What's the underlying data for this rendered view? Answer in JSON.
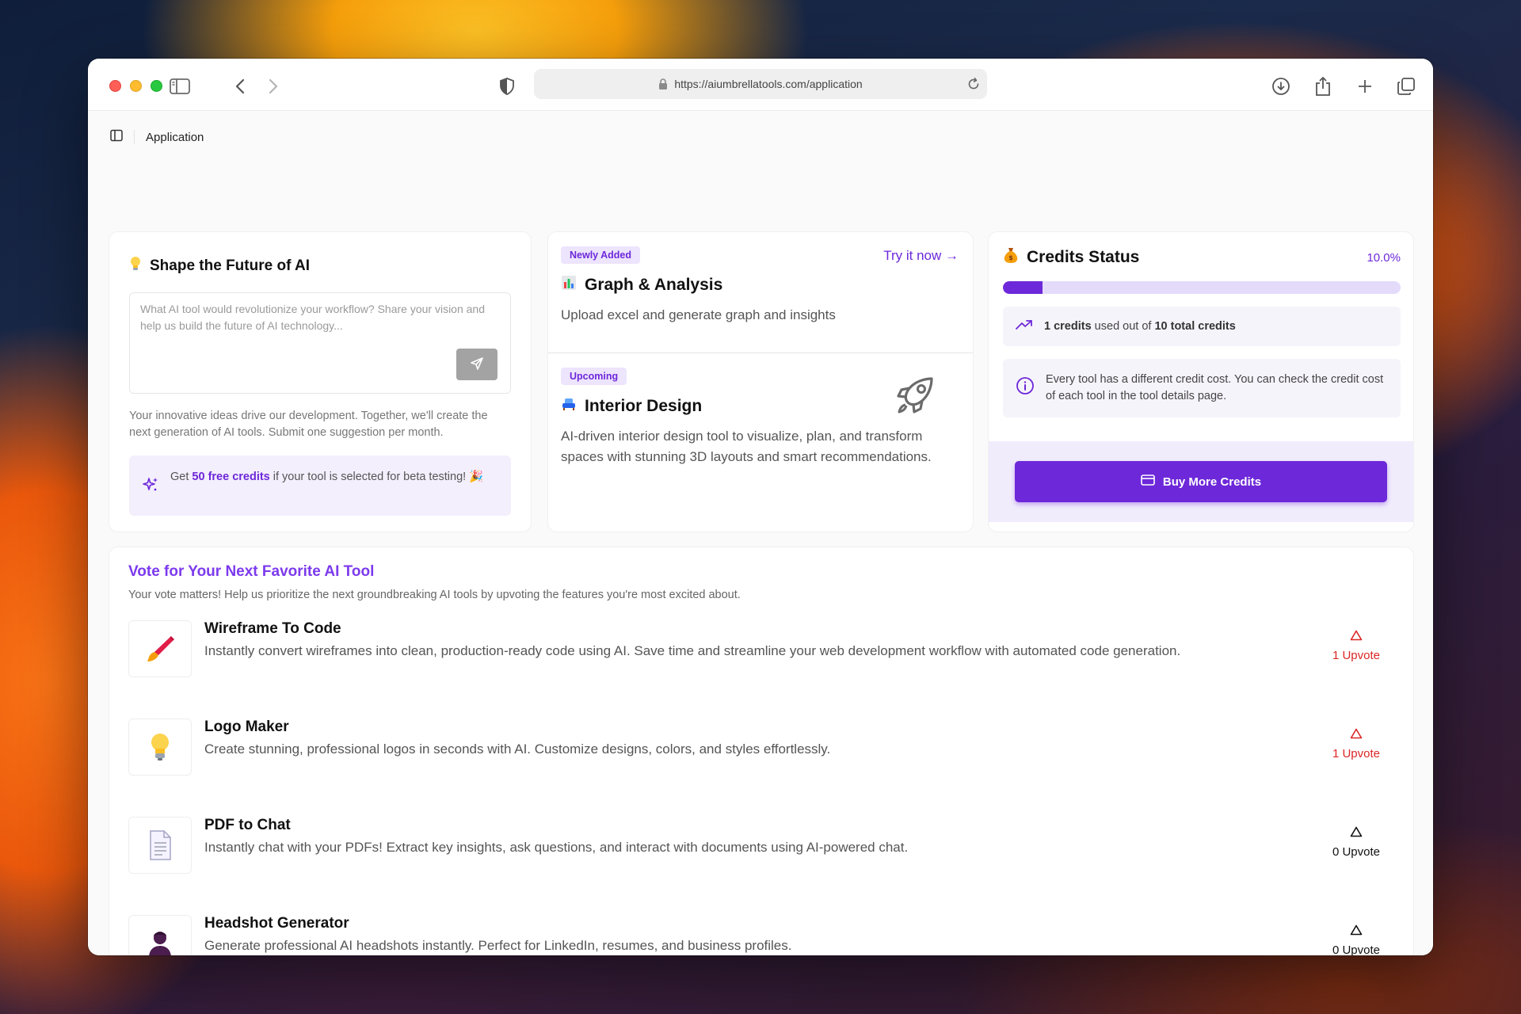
{
  "browser": {
    "url": "https://aiumbrellatools.com/application"
  },
  "breadcrumb": {
    "current": "Application"
  },
  "suggest": {
    "title": "Shape the Future of AI",
    "placeholder": "What AI tool would revolutionize your workflow? Share your vision and help us build the future of AI technology...",
    "description": "Your innovative ideas drive our development. Together, we'll create the next generation of AI tools. Submit one suggestion per month.",
    "promo_prefix": "Get ",
    "promo_highlight": "50 free credits",
    "promo_suffix": " if your tool is selected for beta testing! 🎉"
  },
  "tools": {
    "graph": {
      "badge": "Newly Added",
      "link": "Try it now →",
      "title": "Graph & Analysis",
      "description": "Upload excel and generate graph and insights"
    },
    "interior": {
      "badge": "Upcoming",
      "title": "Interior Design",
      "description": "AI-driven interior design tool to visualize, plan, and transform spaces with stunning 3D layouts and smart recommendations."
    }
  },
  "credits": {
    "title": "Credits Status",
    "percent_label": "10.0%",
    "used_fraction": 0.1,
    "used_bold": "1 credits",
    "used_mid": " used out of ",
    "total_bold": "10 total credits",
    "info": "Every tool has a different credit cost. You can check the credit cost of each tool in the tool details page.",
    "buy_label": "Buy More Credits"
  },
  "vote": {
    "title": "Vote for Your Next Favorite AI Tool",
    "subtitle": "Your vote matters! Help us prioritize the next groundbreaking AI tools by upvoting the features you're most excited about.",
    "items": [
      {
        "name": "Wireframe To Code",
        "description": "Instantly convert wireframes into clean, production-ready code using AI. Save time and streamline your web development workflow with automated code generation.",
        "upvotes": "1 Upvote",
        "icon": "paintbrush-icon",
        "voted": true
      },
      {
        "name": "Logo Maker",
        "description": "Create stunning, professional logos in seconds with AI. Customize designs, colors, and styles effortlessly.",
        "upvotes": "1 Upvote",
        "icon": "lightbulb-icon",
        "voted": true
      },
      {
        "name": "PDF to Chat",
        "description": "Instantly chat with your PDFs! Extract key insights, ask questions, and interact with documents using AI-powered chat.",
        "upvotes": "0 Upvote",
        "icon": "document-icon",
        "voted": false
      },
      {
        "name": "Headshot Generator",
        "description": "Generate professional AI headshots instantly. Perfect for LinkedIn, resumes, and business profiles.",
        "upvotes": "0 Upvote",
        "icon": "person-silhouette-icon",
        "voted": false
      }
    ]
  },
  "colors": {
    "accent": "#6d28d9",
    "upvote_active": "#dc2626"
  }
}
